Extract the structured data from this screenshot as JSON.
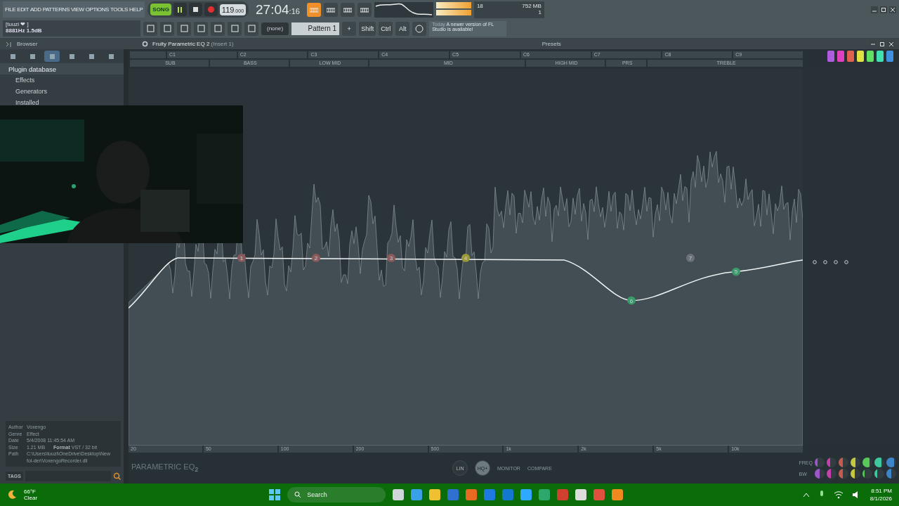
{
  "menu": [
    "FILE",
    "EDIT",
    "ADD",
    "PATTERNS",
    "VIEW",
    "OPTIONS",
    "TOOLS",
    "HELP"
  ],
  "transport": {
    "mode": "SONG",
    "song_mode": true,
    "tempo": "119",
    "tempo_decimals": ".000",
    "time": "27:04",
    "time_fraction": ":16"
  },
  "toolbar_toggles": [
    {
      "on": true
    },
    {
      "on": false
    },
    {
      "on": false
    },
    {
      "on": false
    }
  ],
  "cpu": {
    "voices": "18",
    "memory": "752 MB",
    "count": "1"
  },
  "hint": {
    "line1": "[tuuzi ❤ ]",
    "line2": "8881Hz 1.5dB"
  },
  "pattern": {
    "selector": "(none)",
    "name": "Pattern 1",
    "add": "+"
  },
  "modifiers": [
    "Shift",
    "Ctrl",
    "Alt"
  ],
  "news": {
    "when": "Today",
    "message": "A newer version of FL Studio is available!"
  },
  "browser": {
    "title": "Browser",
    "tabs": [
      {
        "selected": false
      },
      {
        "selected": false
      },
      {
        "selected": true
      },
      {
        "selected": false
      },
      {
        "selected": false
      },
      {
        "selected": false
      }
    ],
    "tree": [
      {
        "label": "Plugin database",
        "expanded": true,
        "children": [
          {
            "label": "Effects"
          },
          {
            "label": "Generators"
          },
          {
            "label": "Installed"
          }
        ]
      }
    ],
    "info": [
      {
        "label": "Author",
        "value": "Voxengo"
      },
      {
        "label": "Genre",
        "value": "Effect"
      },
      {
        "label": "Date",
        "value": "5/4/2008 11:45:54 AM"
      },
      {
        "label": "Size",
        "value": "1.21 MB",
        "extra_label": "Format",
        "extra_value": "VST / 32 bit"
      },
      {
        "label": "Path",
        "value": "C:\\Users\\tuuzi\\OneDrive\\Desktop\\New fol-der\\VoxengoRecorder.dll"
      }
    ],
    "tags": "TAGS"
  },
  "plugin": {
    "title": "Fruity Parametric EQ 2",
    "insert": "(Insert 1)",
    "presets": "Presets",
    "notes": [
      "C1",
      "C2",
      "C3",
      "C4",
      "C5",
      "C6",
      "C7",
      "C8",
      "C9"
    ],
    "ranges": [
      "SUB",
      "BASS",
      "LOW MID",
      "MID",
      "HIGH MID",
      "PRS",
      "TREBLE"
    ],
    "nodes": [
      {
        "label": "1",
        "color": "#8a5a5a"
      },
      {
        "label": "2",
        "color": "#8a5a5a"
      },
      {
        "label": "3",
        "color": "#8a5a5a"
      },
      {
        "label": "4",
        "color": "#9a9a3a"
      },
      {
        "label": "6",
        "color": "#3a9a6a"
      },
      {
        "label": "7",
        "color": "#6a7278"
      },
      {
        "label": "5",
        "color": "#3a9a6a"
      }
    ],
    "freq_labels": [
      "20",
      "50",
      "100",
      "200",
      "500",
      "1k",
      "2k",
      "5k",
      "10k"
    ],
    "logo": "PARAMETRIC EQ",
    "logo_sub": "2",
    "buttons": [
      {
        "label": "LIN",
        "on": false
      },
      {
        "label": "HQ+",
        "on": true
      }
    ],
    "monitor": "MONITOR",
    "compare": "COMPARE",
    "knob_rows": [
      "FREQ",
      "BW"
    ],
    "bands": [
      {
        "color": "#b05ce0",
        "freq": {
          "level": 0.3
        },
        "bw": {
          "level": 0.5
        }
      },
      {
        "color": "#e040c0",
        "freq": {
          "level": 0.35
        },
        "bw": {
          "level": 0.4
        }
      },
      {
        "color": "#e06050",
        "freq": {
          "level": 0.4
        },
        "bw": {
          "level": 0.4
        }
      },
      {
        "color": "#e0e040",
        "freq": {
          "level": 0.5
        },
        "bw": {
          "level": 0.4
        }
      },
      {
        "color": "#60e060",
        "freq": {
          "level": 0.7
        },
        "bw": {
          "level": 0.2
        }
      },
      {
        "color": "#40e0b0",
        "freq": {
          "level": 0.75
        },
        "bw": {
          "level": 0.3
        }
      },
      {
        "color": "#4090e0",
        "freq": {
          "level": 0.8
        },
        "bw": {
          "level": 0.5
        }
      }
    ]
  },
  "taskbar": {
    "weather": {
      "temp": "66°F",
      "condition": "Clear"
    },
    "search": "Search",
    "clock": {
      "time": "8:51 PM",
      "date": "8/1/2026"
    }
  }
}
